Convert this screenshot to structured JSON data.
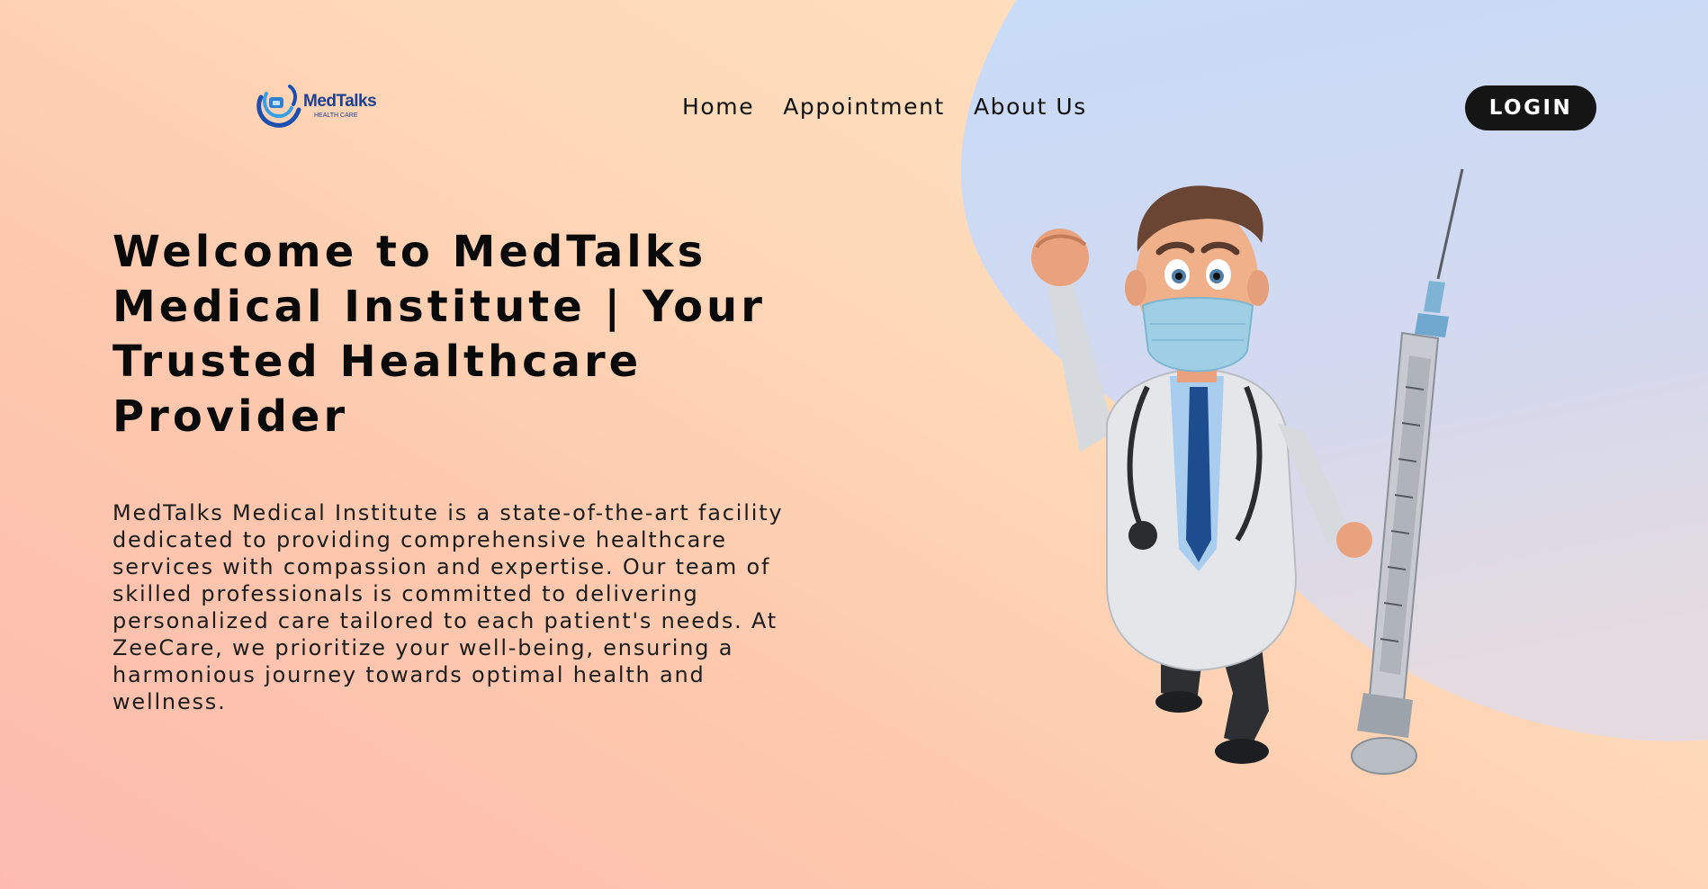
{
  "brand": {
    "name": "MedTalks",
    "tagline": "HEALTH CARE"
  },
  "nav": {
    "links": [
      {
        "label": "Home"
      },
      {
        "label": "Appointment"
      },
      {
        "label": "About Us"
      }
    ],
    "login_label": "LOGIN"
  },
  "hero": {
    "title": "Welcome to MedTalks Medical Institute | Your Trusted Healthcare Provider",
    "description": "MedTalks Medical Institute is a state-of-the-art facility dedicated to providing comprehensive healthcare services with compassion and expertise. Our team of skilled professionals is committed to delivering personalized care tailored to each patient's needs. At ZeeCare, we prioritize your well-being, ensuring a harmonious journey towards optimal health and wellness.",
    "image": "doctor-with-syringe-illustration"
  },
  "colors": {
    "background_start": "#fdbbb0",
    "background_end": "#fee3c3",
    "blob": "#cad9f5",
    "login_button": "#151515",
    "brand_blue": "#1f3f8f"
  }
}
